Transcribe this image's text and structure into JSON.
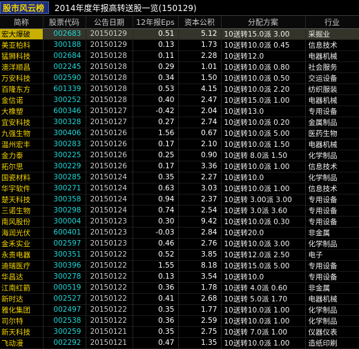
{
  "header": {
    "tag": "股市风云榜",
    "title": "2014年度年报高转送股一览(150129)"
  },
  "columns": [
    "简称",
    "股票代码",
    "公告日期",
    "12年报Eps",
    "资本公积",
    "分配方案",
    "行业"
  ],
  "rows": [
    [
      "宏大爆破",
      "002683",
      "20150129",
      "0.51",
      "5.12",
      "10送转15.0派 3.00",
      "采掘业"
    ],
    [
      "美亚柏科",
      "300188",
      "20150129",
      "0.13",
      "1.73",
      "10送转10.0派 0.45",
      "信息技术"
    ],
    [
      "猛狮科技",
      "002684",
      "20150128",
      "0.11",
      "2.28",
      "10送转12.0",
      "电器机械"
    ],
    [
      "澳洋顺昌",
      "002245",
      "20150128",
      "0.29",
      "1.01",
      "10送转10.0派 0.80",
      "社会服务"
    ],
    [
      "万安科技",
      "002590",
      "20150128",
      "0.34",
      "1.50",
      "10送转10.0派 0.50",
      "交运设备"
    ],
    [
      "百隆东方",
      "601339",
      "20150128",
      "0.53",
      "4.15",
      "10送转10.0派 2.20",
      "纺织服装"
    ],
    [
      "金信诺",
      "300252",
      "20150128",
      "0.40",
      "2.47",
      "10送转15.0派 1.00",
      "电器机械"
    ],
    [
      "大橡塑",
      "600346",
      "20150127",
      "-0.42",
      "2.04",
      "10送转13.0",
      "专用设备"
    ],
    [
      "宜安科技",
      "300328",
      "20150127",
      "0.27",
      "2.74",
      "10送转10.0派 0.20",
      "金属制品"
    ],
    [
      "九强生物",
      "300406",
      "20150126",
      "1.56",
      "0.67",
      "10送转10.0派 5.00",
      "医药生物"
    ],
    [
      "温州宏丰",
      "300283",
      "20150126",
      "0.17",
      "2.10",
      "10送转10.0派 1.50",
      "电器机械"
    ],
    [
      "金力泰",
      "300225",
      "20150126",
      "0.25",
      "0.90",
      "10送转 8.0派 1.50",
      "化学制品"
    ],
    [
      "拓尔思",
      "300229",
      "20150126",
      "0.17",
      "3.36",
      "10送转10.0派 1.00",
      "信息技术"
    ],
    [
      "国瓷材料",
      "300285",
      "20150124",
      "0.35",
      "2.27",
      "10送转10.0",
      "化学制品"
    ],
    [
      "华宇软件",
      "300271",
      "20150124",
      "0.63",
      "3.03",
      "10送转10.0派 1.00",
      "信息技术"
    ],
    [
      "楚天科技",
      "300358",
      "20150124",
      "0.94",
      "2.37",
      "10送转 3.00派 3.00",
      "专用设备"
    ],
    [
      "三诺生物",
      "300298",
      "20150124",
      "0.74",
      "2.54",
      "10送转 3.0派 3.60",
      "专用设备"
    ],
    [
      "南风股份",
      "300004",
      "20150123",
      "0.30",
      "9.42",
      "10送转10.0派 0.30",
      "专用设备"
    ],
    [
      "海润光伏",
      "600401",
      "20150123",
      "-0.03",
      "2.84",
      "10送转20.0",
      "非金属"
    ],
    [
      "金禾实业",
      "002597",
      "20150123",
      "0.46",
      "2.76",
      "10送转10.0派 3.00",
      "化学制品"
    ],
    [
      "永贵电器",
      "300351",
      "20150122",
      "0.52",
      "3.85",
      "10送转12.0派 2.50",
      "电子"
    ],
    [
      "迪瑞医疗",
      "300396",
      "20150122",
      "1.55",
      "8.18",
      "10送转15.0派 5.00",
      "专用设备"
    ],
    [
      "华昌达",
      "300278",
      "20150122",
      "0.13",
      "3.54",
      "10送转10.0",
      "专用设备"
    ],
    [
      "江南红箭",
      "000519",
      "20150122",
      "0.36",
      "1.78",
      "10送转 4.0派 0.60",
      "非金属"
    ],
    [
      "新时达",
      "002527",
      "20150122",
      "0.41",
      "2.68",
      "10送转 5.0派 1.70",
      "电器机械"
    ],
    [
      "雅化集团",
      "002497",
      "20150122",
      "0.35",
      "1.77",
      "10送转10.0派 1.00",
      "化学制品"
    ],
    [
      "司尔特",
      "002538",
      "20150122",
      "0.36",
      "2.59",
      "10送转10.0派 1.00",
      "化学制品"
    ],
    [
      "新天科技",
      "300259",
      "20150121",
      "0.35",
      "2.75",
      "10送转 7.0派 1.00",
      "仪器仪表"
    ],
    [
      "飞动漫",
      "002292",
      "20150121",
      "0.47",
      "1.35",
      "10送转10.0派 1.00",
      "造纸印刷"
    ]
  ]
}
